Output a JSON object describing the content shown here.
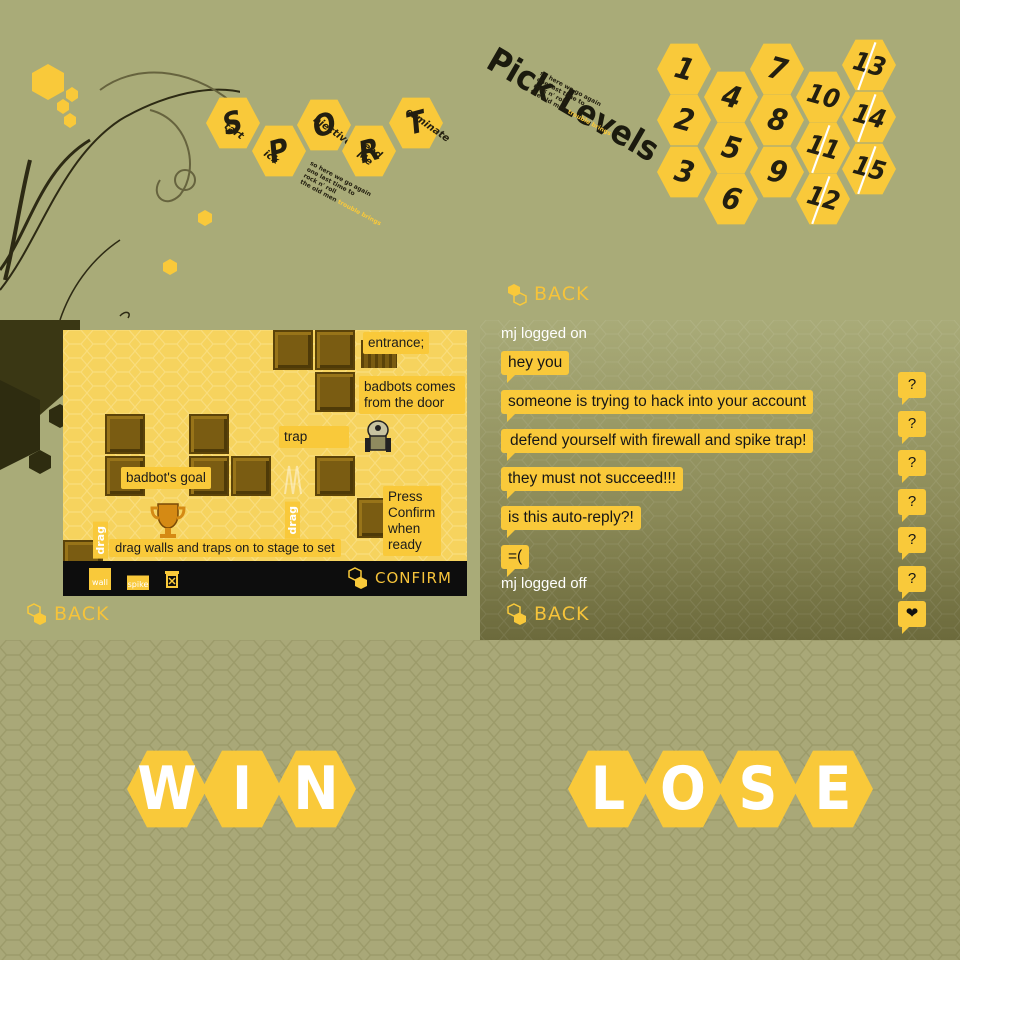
{
  "menu": {
    "items": [
      {
        "letter": "S",
        "word": "tart"
      },
      {
        "letter": "P",
        "word": "ick"
      },
      {
        "letter": "O",
        "word": "bjective"
      },
      {
        "letter": "R",
        "word": "ead Me"
      },
      {
        "letter": "T",
        "word": "erminate"
      }
    ],
    "tiny_text": [
      "so here we go again",
      "one last time to",
      "rock n' roll",
      "the old men"
    ],
    "tiny_highlight": "trouble brings",
    "colors": {
      "bg": "#a9ab78",
      "hex": "#f9c93a",
      "ink": "#231f10"
    }
  },
  "levels": {
    "title": "Pick Levels",
    "tiny_text": [
      "so here we go again",
      "one last time to",
      "rock n' roll",
      "the old men"
    ],
    "tiny_highlight": "trouble brings",
    "numbers": [
      "1",
      "2",
      "3",
      "4",
      "5",
      "6",
      "7",
      "8",
      "9",
      "10",
      "11",
      "12",
      "13",
      "14",
      "15"
    ],
    "back_label": "BACK"
  },
  "game": {
    "callouts": {
      "entrance": "entrance;",
      "badbots_door": "badbots comes from the door",
      "trap": "trap",
      "goal": "badbot's goal",
      "confirm_hint": "Press Confirm when ready",
      "drag_hint": "drag walls and traps on to stage to set"
    },
    "drag_label": "drag",
    "toolbar": {
      "wall_label": "wall",
      "spike_label": "spike",
      "confirm_label": "CONFIRM"
    },
    "back_label": "BACK"
  },
  "chat": {
    "logged_on": "mj logged on",
    "messages": [
      "hey you",
      "someone is trying to hack into your account",
      "defend yourself with firewall and spike trap!",
      "they must not succeed!!!",
      "is this auto-reply?!",
      "=("
    ],
    "logged_off": "mj logged off",
    "question": "?",
    "heart": "❤",
    "back_label": "BACK"
  },
  "end": {
    "win": [
      "W",
      "I",
      "N"
    ],
    "lose": [
      "L",
      "O",
      "S",
      "E"
    ]
  }
}
